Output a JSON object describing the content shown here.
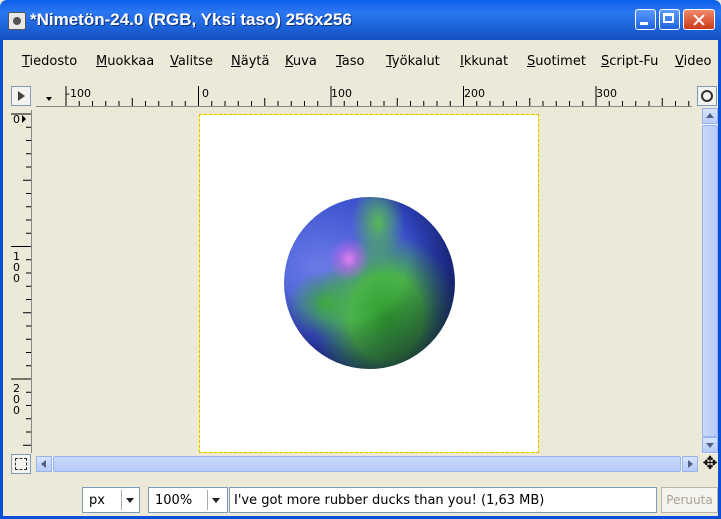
{
  "window": {
    "title": "*Nimetön-24.0 (RGB, Yksi taso) 256x256"
  },
  "menu": {
    "items": [
      "Tiedosto",
      "Muokkaa",
      "Valitse",
      "Näytä",
      "Kuva",
      "Taso",
      "Työkalut",
      "Ikkunat",
      "Suotimet",
      "Script-Fu",
      "Video"
    ]
  },
  "rulers": {
    "horizontal_labels": [
      "-100",
      "0",
      "100",
      "200",
      "300"
    ],
    "vertical_labels": [
      "0",
      "100",
      "200"
    ]
  },
  "status": {
    "unit": "px",
    "zoom": "100%",
    "message": "I've got more rubber ducks than you! (1,63 MB)",
    "cancel_label": "Peruuta"
  },
  "colors": {
    "titlebar": "#1d62d8",
    "window_bg": "#ece9d8",
    "selection_marching_ants": "#e5c000"
  }
}
